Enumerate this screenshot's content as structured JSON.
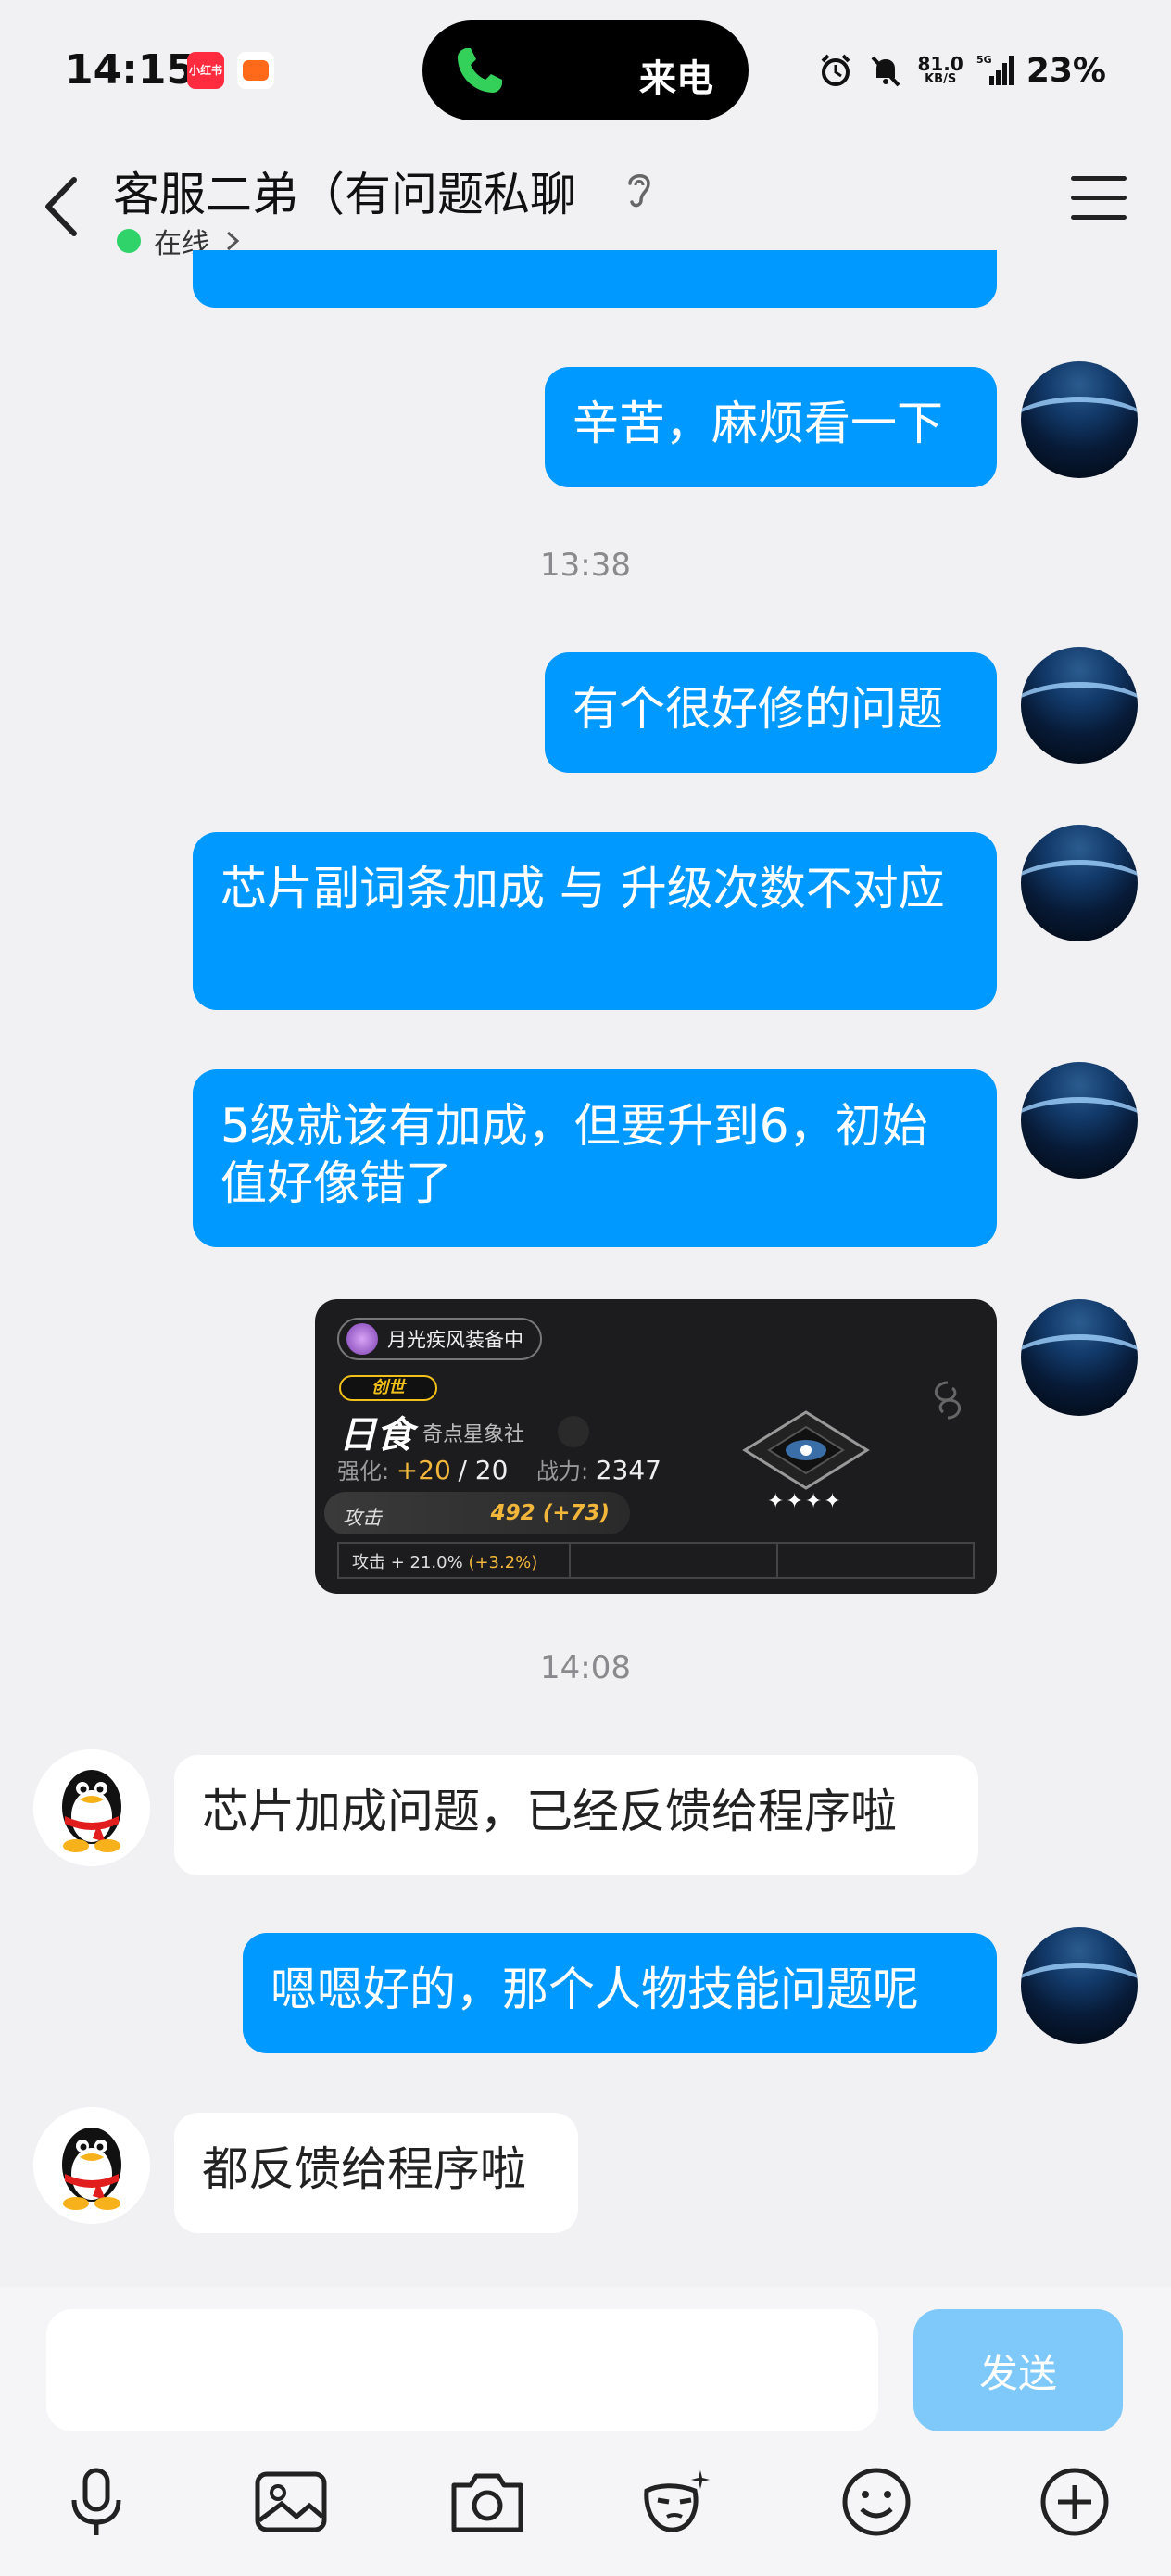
{
  "status_bar": {
    "time": "14:15",
    "app_badge_red": "小红书",
    "call_text": "来电",
    "net_speed": "81.0",
    "net_unit": "KB/S",
    "network_type": "5G",
    "battery": "23%"
  },
  "header": {
    "title": "客服二弟（有问题私聊",
    "status": "在线"
  },
  "messages": [
    {
      "id": "m1",
      "side": "me",
      "text": "辛苦，麻烦看一下"
    },
    {
      "id": "t1",
      "timestamp": "13:38"
    },
    {
      "id": "m2",
      "side": "me",
      "text": "有个很好修的问题"
    },
    {
      "id": "m3",
      "side": "me",
      "text": "芯片副词条加成 与 升级次数不对应"
    },
    {
      "id": "m4",
      "side": "me",
      "text": "5级就该有加成，但要升到6，初始值好像错了"
    },
    {
      "id": "m5",
      "side": "me",
      "type": "image"
    },
    {
      "id": "t2",
      "timestamp": "14:08"
    },
    {
      "id": "m6",
      "side": "them",
      "text": "芯片加成问题，已经反馈给程序啦"
    },
    {
      "id": "m7",
      "side": "me",
      "text": "嗯嗯好的，那个人物技能问题呢"
    },
    {
      "id": "m8",
      "side": "them",
      "text": "都反馈给程序啦"
    }
  ],
  "image_card": {
    "equip_label": "月光疾风装备中",
    "tag": "创世",
    "name": "日食",
    "brand": "奇点星象社",
    "enhance_label": "强化:",
    "enhance_value": "+20",
    "enhance_max": "/ 20",
    "power_label": "战力:",
    "power_value": "2347",
    "attack_label": "攻击",
    "attack_value": "492 (+73)",
    "sub_stat": "攻击 + 21.0%",
    "sub_stat_bonus": "(+3.2%)",
    "stars": "✦✦✦✦"
  },
  "input": {
    "placeholder": "",
    "send_label": "发送"
  },
  "toolbar": [
    "microphone-icon",
    "image-icon",
    "camera-icon",
    "mask-icon",
    "emoji-icon",
    "plus-icon"
  ],
  "colors": {
    "bubble_me": "#0099ff",
    "bubble_them": "#ffffff",
    "background": "#f1f1f4",
    "send_disabled": "#7fc9fa"
  }
}
